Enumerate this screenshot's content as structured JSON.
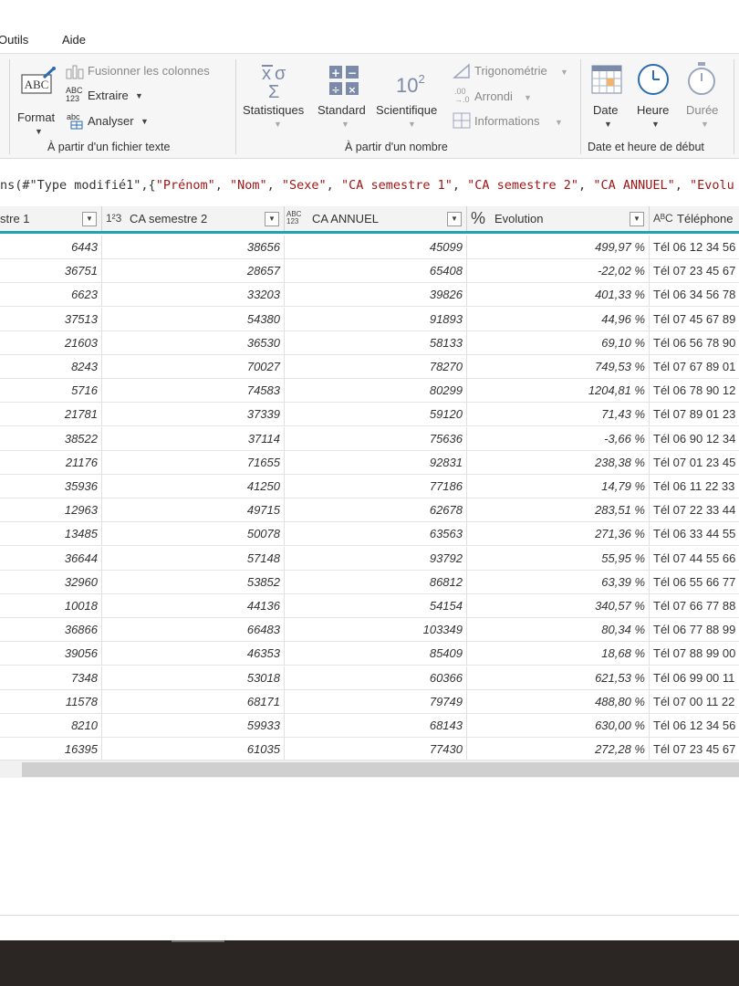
{
  "menu": {
    "items": [
      "Outils",
      "Aide"
    ]
  },
  "ribbon": {
    "text_group": {
      "format_label": "Format",
      "merge_label": "Fusionner les colonnes",
      "extract_label": "Extraire",
      "analyze_label": "Analyser",
      "group_label": "À partir d'un fichier texte"
    },
    "number_group": {
      "statistics_label": "Statistiques",
      "standard_label": "Standard",
      "scientific_label": "Scientifique",
      "trig_label": "Trigonométrie",
      "round_label": "Arrondi",
      "info_label": "Informations",
      "scientific_icon_text": "10",
      "scientific_icon_exp": "2",
      "group_label": "À partir d'un nombre"
    },
    "date_group": {
      "date_label": "Date",
      "time_label": "Heure",
      "duration_label": "Durée",
      "group_label": "Date et heure de début"
    }
  },
  "formula": {
    "prefix": "ns(#\"Type modifié1\",{",
    "parts": [
      "\"Prénom\"",
      ", ",
      "\"Nom\"",
      ", ",
      "\"Sexe\"",
      ", ",
      "\"CA semestre 1\"",
      ", ",
      "\"CA semestre 2\"",
      ", ",
      "\"CA ANNUEL\"",
      ", ",
      "\"Evolu"
    ]
  },
  "columns": [
    {
      "type_icon": "",
      "label": "stre 1"
    },
    {
      "type_icon": "1²3",
      "label": "CA semestre 2"
    },
    {
      "type_icon": "ABC 123",
      "label": "CA ANNUEL"
    },
    {
      "type_icon": "%",
      "label": "Evolution"
    },
    {
      "type_icon": "AᴮC",
      "label": "Téléphone"
    }
  ],
  "rows": [
    [
      "6443",
      "38656",
      "45099",
      "499,97 %",
      "Tél  06 12 34 56"
    ],
    [
      "36751",
      "28657",
      "65408",
      "-22,02 %",
      "Tél  07 23 45 67"
    ],
    [
      "6623",
      "33203",
      "39826",
      "401,33 %",
      "Tél  06 34 56 78"
    ],
    [
      "37513",
      "54380",
      "91893",
      "44,96 %",
      "Tél  07 45 67 89"
    ],
    [
      "21603",
      "36530",
      "58133",
      "69,10 %",
      "Tél  06 56 78 90"
    ],
    [
      "8243",
      "70027",
      "78270",
      "749,53 %",
      "Tél  07 67 89 01"
    ],
    [
      "5716",
      "74583",
      "80299",
      "1204,81 %",
      "Tél  06 78 90 12"
    ],
    [
      "21781",
      "37339",
      "59120",
      "71,43 %",
      "Tél  07 89 01 23"
    ],
    [
      "38522",
      "37114",
      "75636",
      "-3,66 %",
      "Tél  06 90 12 34"
    ],
    [
      "21176",
      "71655",
      "92831",
      "238,38 %",
      "Tél  07 01 23 45"
    ],
    [
      "35936",
      "41250",
      "77186",
      "14,79 %",
      "Tél  06 11 22 33"
    ],
    [
      "12963",
      "49715",
      "62678",
      "283,51 %",
      "Tél  07 22 33 44"
    ],
    [
      "13485",
      "50078",
      "63563",
      "271,36 %",
      "Tél  06 33 44 55"
    ],
    [
      "36644",
      "57148",
      "93792",
      "55,95 %",
      "Tél  07 44 55 66"
    ],
    [
      "32960",
      "53852",
      "86812",
      "63,39 %",
      "Tél  06 55 66 77"
    ],
    [
      "10018",
      "44136",
      "54154",
      "340,57 %",
      "Tél  07 66 77 88"
    ],
    [
      "36866",
      "66483",
      "103349",
      "80,34 %",
      "Tél  06 77 88 99"
    ],
    [
      "39056",
      "46353",
      "85409",
      "18,68 %",
      "Tél  07 88 99 00"
    ],
    [
      "7348",
      "53018",
      "60366",
      "621,53 %",
      "Tél  06 99 00 11"
    ],
    [
      "11578",
      "68171",
      "79749",
      "488,80 %",
      "Tél  07 00 11 22"
    ],
    [
      "8210",
      "59933",
      "68143",
      "630,00 %",
      "Tél  06 12 34 56"
    ],
    [
      "16395",
      "61035",
      "77430",
      "272,28 %",
      "Tél  07 23 45 67"
    ]
  ],
  "colors": {
    "accent": "#1ea4b0",
    "string_red": "#a31515",
    "icon_blue": "#2b6cb0"
  }
}
